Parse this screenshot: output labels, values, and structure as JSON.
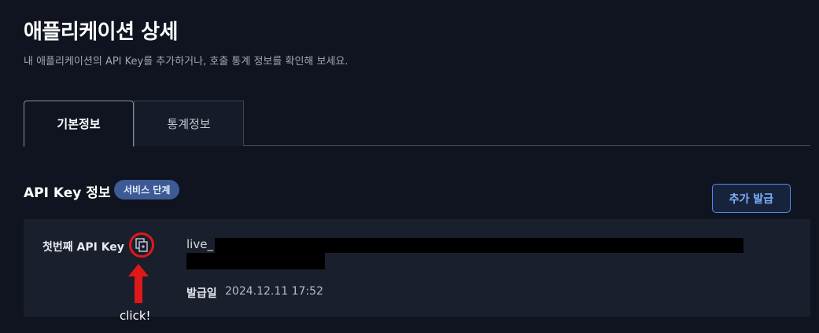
{
  "header": {
    "title": "애플리케이션 상세",
    "subtitle": "내 애플리케이션의 API Key를 추가하거나, 호출 통계 정보를 확인해 보세요."
  },
  "tabs": [
    {
      "label": "기본정보",
      "active": true
    },
    {
      "label": "통계정보",
      "active": false
    }
  ],
  "section": {
    "title": "API Key 정보",
    "badge": "서비스 단계",
    "add_button": "추가 발급"
  },
  "api_key": {
    "label": "첫번째 API Key",
    "value_prefix": "live_",
    "issued_label": "발급일",
    "issued_value": "2024.12.11 17:52"
  },
  "annotation": {
    "text": "click!"
  },
  "colors": {
    "background": "#0f1420",
    "card": "#1a1f2e",
    "accent": "#4d8df0",
    "badge": "#3d5a94",
    "annotation": "#e01818"
  }
}
